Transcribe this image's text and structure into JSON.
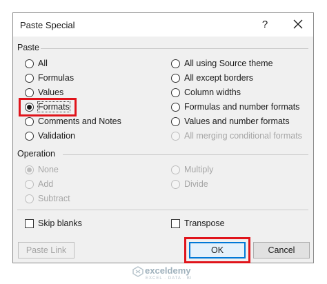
{
  "dialog": {
    "title": "Paste Special",
    "help_label": "?"
  },
  "paste": {
    "label": "Paste",
    "left_options": [
      {
        "label": "All",
        "checked": false
      },
      {
        "label": "Formulas",
        "checked": false
      },
      {
        "label": "Values",
        "checked": false
      },
      {
        "label": "Formats",
        "checked": true
      },
      {
        "label": "Comments and Notes",
        "checked": false
      },
      {
        "label": "Validation",
        "checked": false
      }
    ],
    "right_options": [
      {
        "label": "All using Source theme",
        "enabled": true
      },
      {
        "label": "All except borders",
        "enabled": true
      },
      {
        "label": "Column widths",
        "enabled": true
      },
      {
        "label": "Formulas and number formats",
        "enabled": true
      },
      {
        "label": "Values and number formats",
        "enabled": true
      },
      {
        "label": "All merging conditional formats",
        "enabled": false
      }
    ]
  },
  "operation": {
    "label": "Operation",
    "left_options": [
      {
        "label": "None",
        "checked": true
      },
      {
        "label": "Add",
        "checked": false
      },
      {
        "label": "Subtract",
        "checked": false
      }
    ],
    "right_options": [
      {
        "label": "Multiply",
        "checked": false
      },
      {
        "label": "Divide",
        "checked": false
      }
    ]
  },
  "checkboxes": {
    "skip_blanks": "Skip blanks",
    "transpose": "Transpose"
  },
  "buttons": {
    "paste_link": "Paste Link",
    "ok": "OK",
    "cancel": "Cancel"
  },
  "watermark": {
    "name": "exceldemy",
    "tagline": "EXCEL · DATA · BI"
  },
  "colors": {
    "highlight": "#e0141b",
    "dialog_bg": "#f0f0f0",
    "ok_border": "#0078d7"
  }
}
